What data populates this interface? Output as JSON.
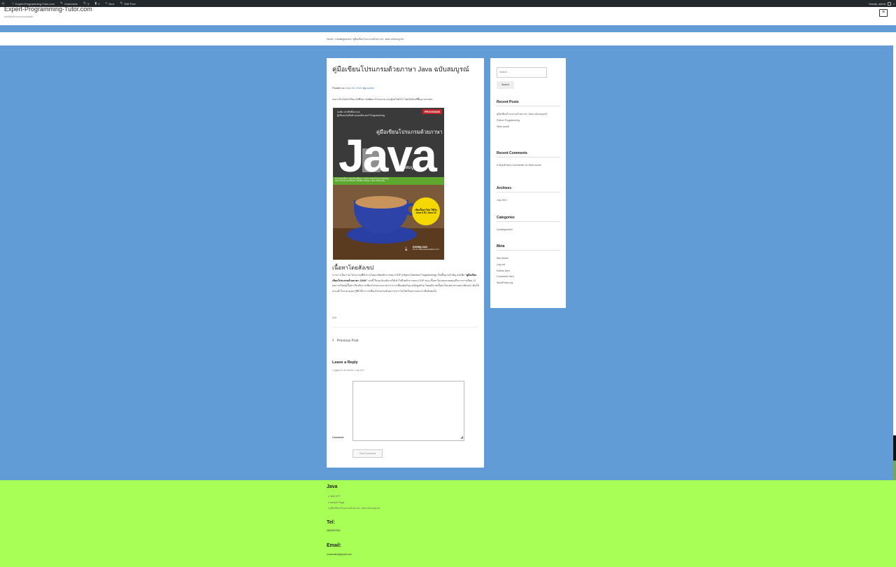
{
  "admin_bar": {
    "site_name": "Expert-Programming-Tutor.com",
    "customize": "Customize",
    "updates_count": "5",
    "comments_count": "0",
    "new": "New",
    "edit_post": "Edit Post",
    "howdy": "Howdy, admin"
  },
  "header": {
    "site_title": "Expert-Programming-Tutor.com",
    "tagline": "สอนเขียนโปรแกรมแบบตัวต่อตัว",
    "menu_icon": "≡"
  },
  "breadcrumb": "Home / Uncategorized / คู่มือเขียนโปรแกรมด้วยภาษา Java ฉบับสมบูรณ์",
  "article": {
    "title": "คู่มือเขียนโปรแกรมด้วยภาษา Java ฉบับสมบูรณ์",
    "posted_on_label": "Posted on",
    "date": "July 26, 2021",
    "by_label": "by",
    "author": "admin",
    "intro": "เหมาะสำหรับนักเรียน นักศึกษา นักพัฒนาโปรแกรม และผู้สนใจทั่วไป โดยไม่ต้องมีพื้นฐานมาก่อน",
    "cover": {
      "brand": "PROVISION",
      "authors": "ธงชัย ประสิทธิ์ธนากุล",
      "authors_sub": "ผู้เขียนหนังสือด้านคอมพิวเตอร์ Programming",
      "top_title": "คู่มือเขียนโปรแกรมด้วยภาษา",
      "big_word": "Java",
      "edition": "ฉบับสมบูรณ์",
      "green_line1": "ครอบคลุมเนื้อหา Java ตั้งแต่พื้นฐาน จนถึงการเขียนโปรแกรมเชิงวัตถุ",
      "green_line2": "New Java 15 Text Blocks / Multiline Strings / Java 16 Records",
      "badge": "เพิ่มเนื้อหาใหม่ ใช้กับ Java 8 ถึง Java 16",
      "download": "DOWNLOAD",
      "download_sub": "ตัวอย่างโค้ด www.provision.co.th"
    },
    "section_heading": "เนื้อหาโดยสังเขป",
    "body_pre": "การการเป็นภาษาโปรแกรมที่ทำงานโดยอาศัยหลักการของ OOP (Object Oriented Programming) เป็นพื้นฐานสำคัญ หนังสือ ",
    "body_bold": "\"คู่มือเรียนเขียนโปรแกรมด้วยภาษา JAVA\"",
    "body_post": " เล่มนี้ จึงมุ่งเน้นอธิบายให้เข้าใจถึงหลักการของ OOP ก่อน เนื้อหาในเล่มครอบคลุมถึงการการเขียน 12 ผลการเรียนรู้เนื้อหาเกี่ยวกับการเขียนโปรแกรมภาษาการการเชื่อมต่อกับฐานข้อมูลด้วย โดยอธิบายเนื้อหาในแต่ละส่วนอย่างชัดเจน เน้นให้อ่านเข้าใจง่าย คุณจะรู้สึกได้ว่าการเขียนโปรแกรมด้วยภาษาการไม่ใช่เรื่องยากและน่าเบื่ออีกต่อไป",
    "edit": "Edit",
    "prev_arrow": "‹",
    "prev_post": "Previous Post",
    "reply_title": "Leave a Reply",
    "logged_in": "Logged in as admin. Log out?",
    "comment_label": "Comment",
    "post_comment": "Post Comment"
  },
  "sidebar": {
    "search_placeholder": "Search …",
    "search_button": "Search",
    "recent_posts_title": "Recent Posts",
    "recent_posts": [
      "คู่มือเขียนโปรแกรมด้วยภาษา Java ฉบับสมบูรณ์",
      "Python Programming",
      "Hello world!"
    ],
    "recent_comments_title": "Recent Comments",
    "recent_comment": "A WordPress Commenter on Hello world!",
    "archives_title": "Archives",
    "archives": [
      "July 2021"
    ],
    "categories_title": "Categories",
    "categories": [
      "Uncategorized"
    ],
    "meta_title": "Meta",
    "meta": [
      "Site Admin",
      "Log out",
      "Entries feed",
      "Comments feed",
      "WordPress.org"
    ]
  },
  "footer": {
    "java_title": "Java",
    "links": [
      "Hello EPT",
      "Sample Page",
      "คู่มือเขียนโปรแกรมด้วยภาษา Java ฉบับสมบูรณ์"
    ],
    "tel_label": "Tel:",
    "tel": "0853507540",
    "email_label": "Email:",
    "email": "omanudeo@gmail.com"
  },
  "colors": {
    "page_bg": "#629cd6",
    "footer_bg": "#a8ff55",
    "admin_bar": "#23282d",
    "link": "#4a7fc1"
  }
}
